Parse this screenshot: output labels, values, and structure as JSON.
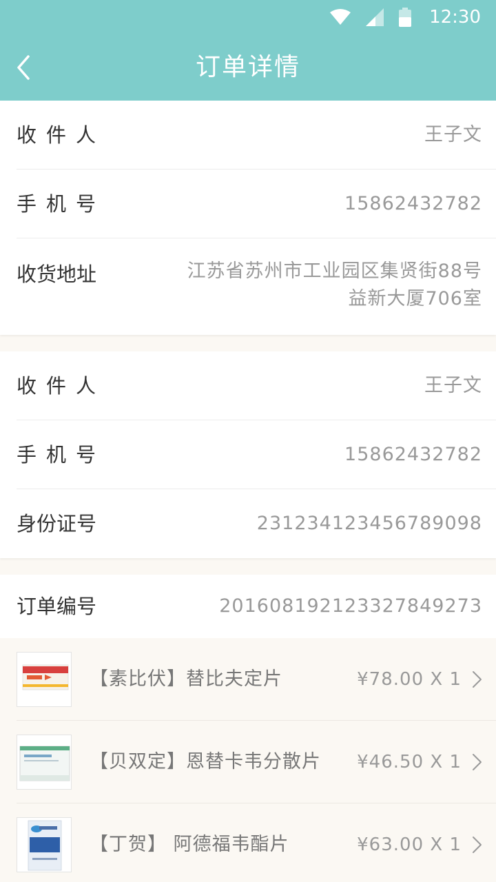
{
  "status_bar": {
    "time": "12:30"
  },
  "header": {
    "title": "订单详情"
  },
  "recipient": {
    "name_label": "收件人",
    "name_value": "王子文",
    "phone_label": "手机号",
    "phone_value": "15862432782",
    "address_label": "收货地址",
    "address_line1": "江苏省苏州市工业园区集贤街88号",
    "address_line2": "益新大厦706室"
  },
  "buyer": {
    "name_label": "收件人",
    "name_value": "王子文",
    "phone_label": "手机号",
    "phone_value": "15862432782",
    "id_label": "身份证号",
    "id_value": "231234123456789098"
  },
  "order": {
    "number_label": "订单编号",
    "number_value": "20160819212332784927З",
    "items": [
      {
        "name": "【素比伏】替比夫定片",
        "price": "¥78.00 X 1"
      },
      {
        "name": "【贝双定】恩替卡韦分散片",
        "price": "¥46.50 X 1"
      },
      {
        "name": "【丁贺】 阿德福韦酯片",
        "price": "¥63.00 X 1"
      }
    ]
  },
  "colors": {
    "accent": "#7ecdcb",
    "label": "#333333",
    "value": "#999999"
  }
}
